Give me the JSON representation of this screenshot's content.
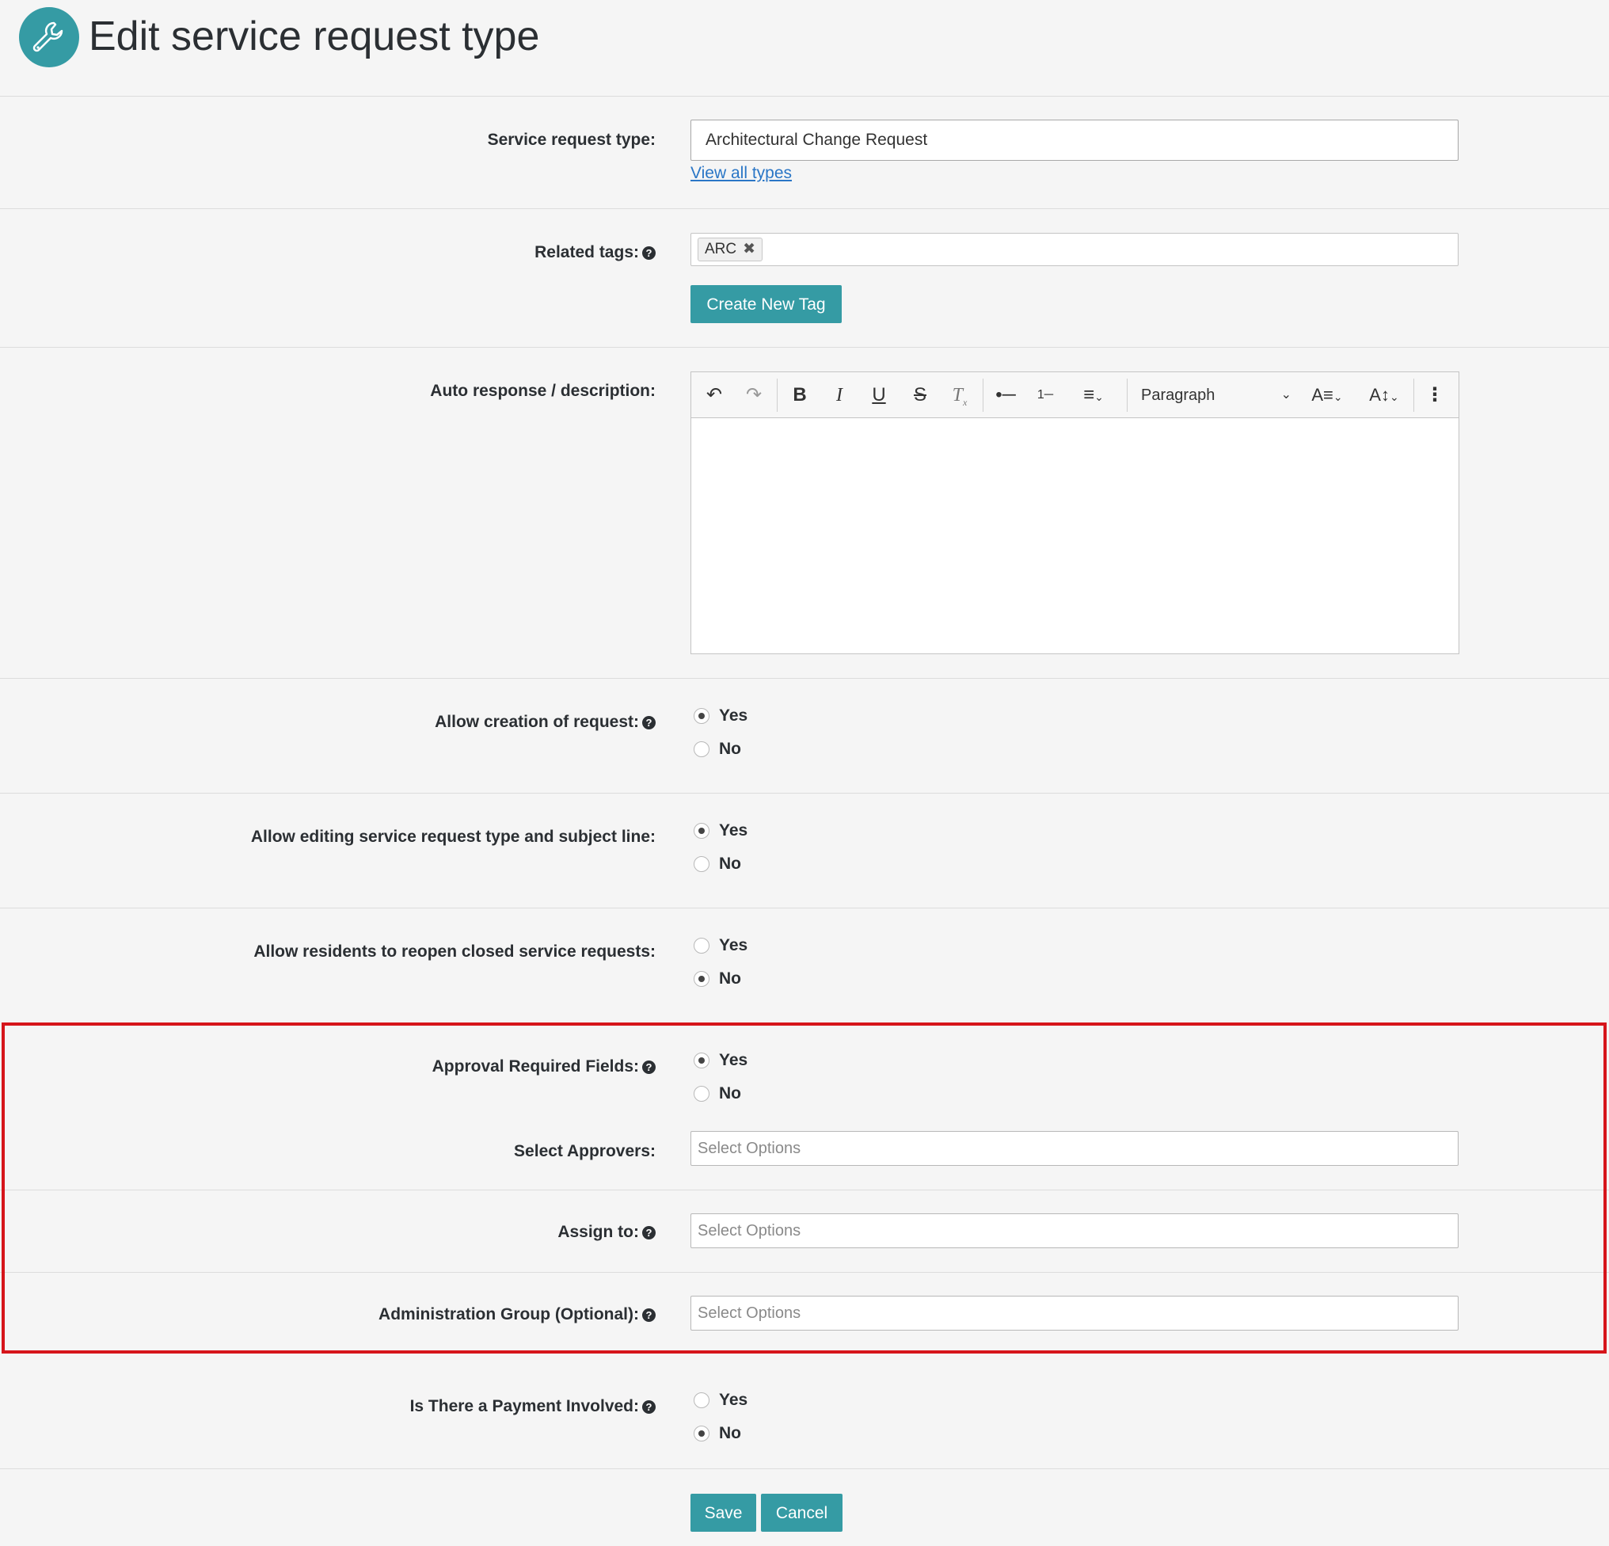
{
  "page": {
    "title": "Edit service request type",
    "header_icon": "wrench-icon"
  },
  "colors": {
    "accent": "#359ba4",
    "link": "#2a76c6",
    "highlight": "#d6151b"
  },
  "service_type": {
    "label": "Service request type:",
    "value": "Architectural Change Request",
    "link": "View all types"
  },
  "tags": {
    "label": "Related tags:",
    "items": [
      {
        "label": "ARC",
        "remove": "✖"
      }
    ],
    "create_button": "Create New Tag"
  },
  "description": {
    "label": "Auto response / description:",
    "toolbar": {
      "paragraph": "Paragraph"
    }
  },
  "allow_creation": {
    "label": "Allow creation of request:",
    "options": [
      "Yes",
      "No"
    ],
    "selected": "Yes"
  },
  "allow_editing": {
    "label": "Allow editing service request type and subject line:",
    "options": [
      "Yes",
      "No"
    ],
    "selected": "Yes"
  },
  "allow_reopen": {
    "label": "Allow residents to reopen closed service requests:",
    "options": [
      "Yes",
      "No"
    ],
    "selected": "No"
  },
  "approval_required": {
    "label": "Approval Required Fields:",
    "options": [
      "Yes",
      "No"
    ],
    "selected": "Yes"
  },
  "approvers": {
    "label": "Select Approvers:",
    "placeholder": "Select Options"
  },
  "assign_to": {
    "label": "Assign to:",
    "placeholder": "Select Options"
  },
  "admin_group": {
    "label": "Administration Group (Optional):",
    "placeholder": "Select Options"
  },
  "payment": {
    "label": "Is There a Payment Involved:",
    "options": [
      "Yes",
      "No"
    ],
    "selected": "No"
  },
  "actions": {
    "save": "Save",
    "cancel": "Cancel"
  }
}
